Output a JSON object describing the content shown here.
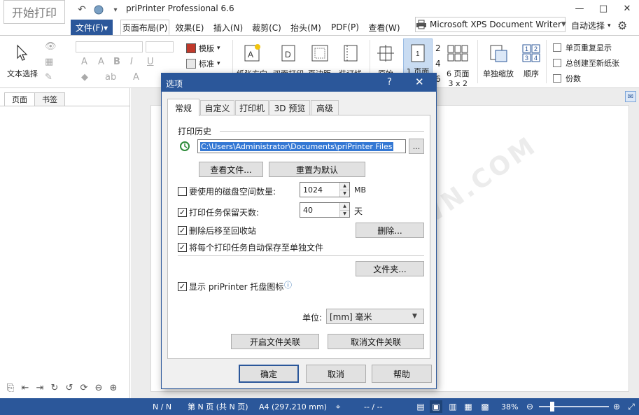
{
  "titlebar": {
    "start_print": "开始打印",
    "app_title": "priPrinter Professional 6.6",
    "minimize": "—",
    "maximize": "□",
    "close": "✕"
  },
  "tabs": {
    "file": "文件(F)▾",
    "items": [
      "页面布局(P)",
      "效果(E)",
      "插入(N)",
      "裁剪(C)",
      "抬头(M)",
      "PDF(P)",
      "查看(W)"
    ]
  },
  "printer": {
    "name": "Microsoft XPS Document Writer",
    "auto_select": "自动选择"
  },
  "ribbon": {
    "text_select": "文本选择",
    "template": "模版",
    "standard": "标准",
    "paper_direction": "纸张方向",
    "duplex": "双面打印",
    "margins": "页边距",
    "binding": "装订线",
    "origin": "原始",
    "one_page": "1 页面",
    "n2": "2",
    "n4": "4",
    "n6": "6",
    "six_pages": "6 页面",
    "grid": "3 x 2",
    "single_scale": "单独缩放",
    "order": "顺序",
    "options": [
      "单页重复显示",
      "总创建至新纸张",
      "份数"
    ]
  },
  "sidebar": {
    "tabs": [
      "页面",
      "书签"
    ]
  },
  "watermark": "WEIDOWN.COM",
  "statusbar": {
    "page_count": "N / N",
    "page_of": "第 N 页 (共 N 页)",
    "paper": "A4 (297,210 mm)",
    "coords": "-- / --",
    "zoom": "38%"
  },
  "dialog": {
    "title": "选项",
    "help_q": "?",
    "close": "✕",
    "tabs": [
      "常规",
      "自定义",
      "打印机",
      "3D 预览",
      "高级"
    ],
    "print_history_title": "打印历史",
    "history_path": "C:\\Users\\Administrator\\Documents\\priPrinter Files",
    "browse": "...",
    "view_files": "查看文件...",
    "reset_default": "重置为默认",
    "disk_space_label": "要使用的磁盘空间数量:",
    "disk_space_value": "1024",
    "disk_space_unit": "MB",
    "keep_days_label": "打印任务保留天数:",
    "keep_days_value": "40",
    "keep_days_unit": "天",
    "recycle_label": "删除后移至回收站",
    "delete_btn": "删除...",
    "autosave_label": "将每个打印任务自动保存至单独文件",
    "folder_btn": "文件夹...",
    "tray_label": "显示 priPrinter 托盘图标",
    "info": "ⓘ",
    "unit_label": "单位:",
    "unit_value": "[mm]  毫米",
    "enable_assoc": "开启文件关联",
    "cancel_assoc": "取消文件关联",
    "ok": "确定",
    "cancel": "取消",
    "help": "帮助",
    "disk_space_checked": false,
    "keep_days_checked": true,
    "recycle_checked": true,
    "autosave_checked": true,
    "tray_checked": true
  }
}
